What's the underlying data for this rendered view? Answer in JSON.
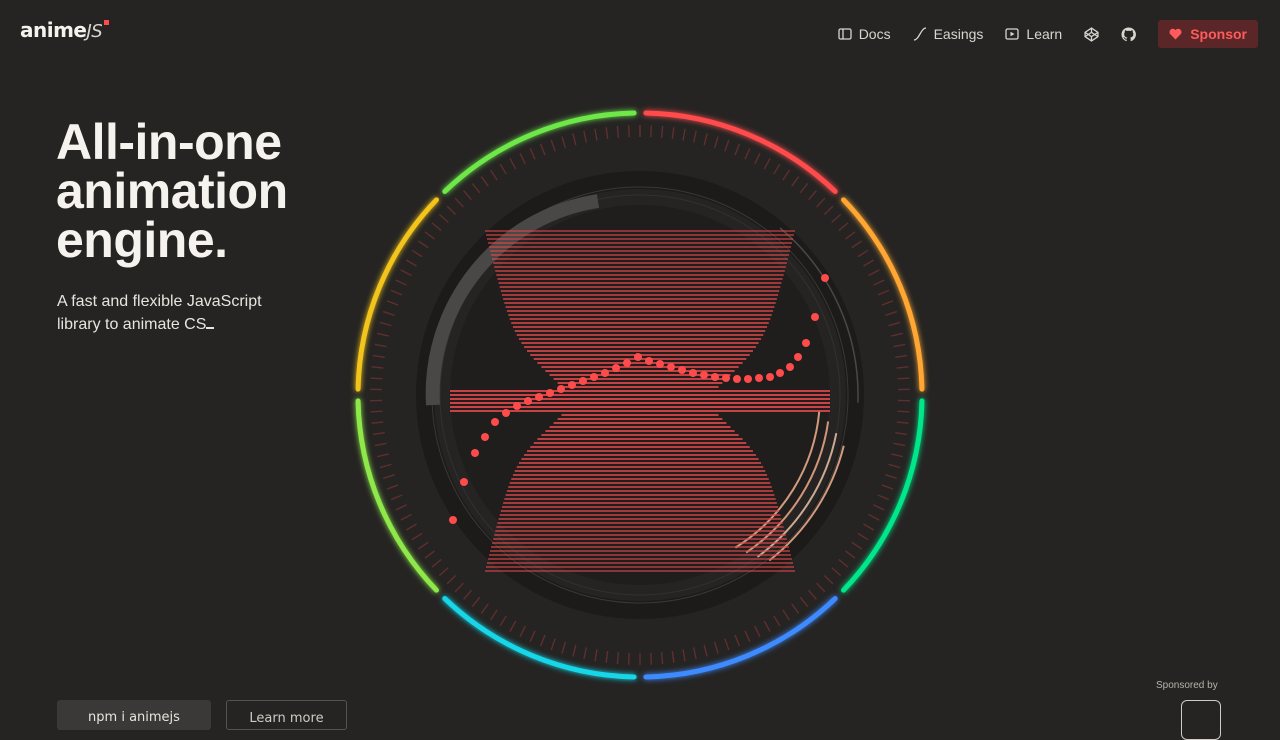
{
  "brand": {
    "name_main": "anime",
    "name_suffix": "JS",
    "accent": "#ff4b4b"
  },
  "nav": {
    "items": [
      {
        "label": "Docs",
        "icon": "docs-icon"
      },
      {
        "label": "Easings",
        "icon": "easing-curve-icon"
      },
      {
        "label": "Learn",
        "icon": "play-icon"
      }
    ],
    "icons": [
      "codepen-icon",
      "github-icon"
    ],
    "sponsor_label": "Sponsor"
  },
  "hero": {
    "title_lines": [
      "All-in-one",
      "animation",
      "engine."
    ],
    "subtitle_line1": "A fast and flexible JavaScript",
    "subtitle_line2": "library to animate CS"
  },
  "buttons": {
    "primary": "npm i animejs",
    "secondary": "Learn more"
  },
  "sponsored_by": "Sponsored by",
  "colors": {
    "background": "#252423",
    "sponsor_bg": "#5b2628",
    "sponsor_text": "#ff5b5b",
    "ring": [
      "#ff4b4b",
      "#ffa733",
      "#00e68a",
      "#3d8bff",
      "#13d6e8",
      "#8ee84a",
      "#f2c41a",
      "#6ee84a"
    ]
  }
}
